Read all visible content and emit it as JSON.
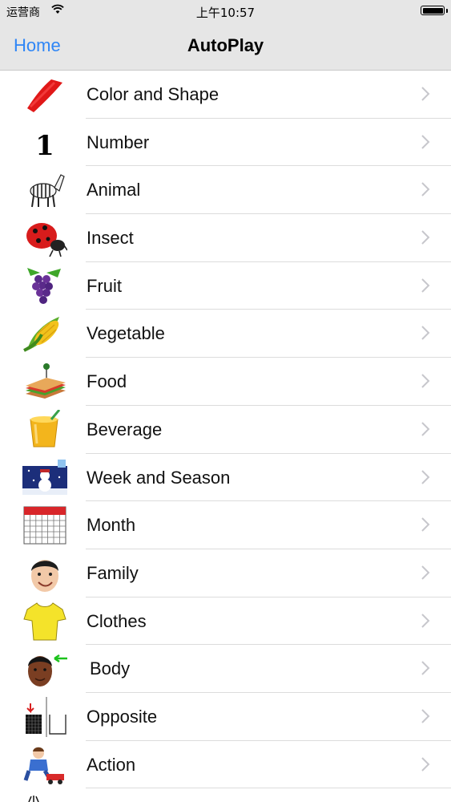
{
  "status_bar": {
    "carrier": "运营商",
    "time": "上午10:57"
  },
  "nav": {
    "back_label": "Home",
    "title": "AutoPlay"
  },
  "categories": [
    {
      "label": "Color and Shape",
      "icon": "red-paint-stroke-icon"
    },
    {
      "label": "Number",
      "icon": "number-one-icon"
    },
    {
      "label": "Animal",
      "icon": "zebra-icon"
    },
    {
      "label": "Insect",
      "icon": "ladybug-icon"
    },
    {
      "label": "Fruit",
      "icon": "grapes-icon"
    },
    {
      "label": "Vegetable",
      "icon": "corn-icon"
    },
    {
      "label": "Food",
      "icon": "sandwich-icon"
    },
    {
      "label": "Beverage",
      "icon": "juice-glass-icon"
    },
    {
      "label": "Week and Season",
      "icon": "snowman-icon"
    },
    {
      "label": "Month",
      "icon": "calendar-icon"
    },
    {
      "label": "Family",
      "icon": "boy-face-icon"
    },
    {
      "label": "Clothes",
      "icon": "tshirt-icon"
    },
    {
      "label": "Body",
      "icon": "body-face-icon"
    },
    {
      "label": "Opposite",
      "icon": "full-empty-icon"
    },
    {
      "label": "Action",
      "icon": "child-playing-icon"
    }
  ]
}
